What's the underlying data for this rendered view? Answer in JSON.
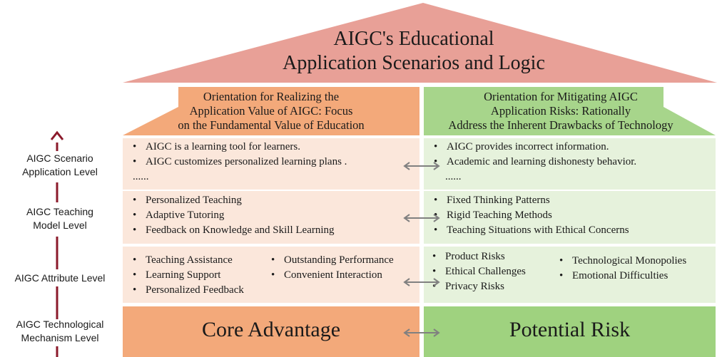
{
  "roof": {
    "title_line1": "AIGC's Educational",
    "title_line2": "Application Scenarios and Logic"
  },
  "left_orientation": {
    "line1": "Orientation for Realizing the",
    "line2": "Application Value of AIGC: Focus",
    "line3": "on the Fundamental Value of Education"
  },
  "right_orientation": {
    "line1": "Orientation for Mitigating AIGC",
    "line2": "Application Risks: Rationally",
    "line3": "Address the Inherent Drawbacks of Technology"
  },
  "levels": {
    "scenario": {
      "line1": "AIGC Scenario",
      "line2": "Application Level"
    },
    "teaching": {
      "line1": "AIGC Teaching",
      "line2": "Model Level"
    },
    "attribute": {
      "line1": "AIGC Attribute Level"
    },
    "mechanism": {
      "line1": "AIGC Technological",
      "line2": "Mechanism Level"
    }
  },
  "scenario_row": {
    "left": [
      "AIGC is a learning tool for learners.",
      "AIGC customizes personalized learning plans ."
    ],
    "left_more": "......",
    "right": [
      "AIGC provides incorrect information.",
      "Academic and learning dishonesty behavior."
    ],
    "right_more": "......"
  },
  "teaching_row": {
    "left": [
      "Personalized Teaching",
      "Adaptive Tutoring",
      "Feedback on Knowledge and Skill Learning"
    ],
    "right": [
      "Fixed Thinking Patterns",
      "Rigid Teaching Methods",
      "Teaching Situations with Ethical Concerns"
    ]
  },
  "attribute_row": {
    "left_col1": [
      "Teaching Assistance",
      "Learning Support",
      "Personalized Feedback"
    ],
    "left_col2": [
      "Outstanding Performance",
      "Convenient Interaction"
    ],
    "right_col1": [
      "Product Risks",
      "Ethical Challenges",
      "Privacy Risks"
    ],
    "right_col2": [
      "Technological Monopolies",
      "Emotional Difficulties"
    ]
  },
  "mechanism_row": {
    "left": "Core Advantage",
    "right": "Potential Risk"
  },
  "colors": {
    "roof": "#e8a097",
    "left_header": "#f3a97a",
    "right_header": "#a7d58b",
    "left_panel": "#fbe7db",
    "right_panel": "#e6f2dc",
    "left_base": "#f3a97a",
    "right_base": "#9fd27f",
    "axis_arrow": "#8b1a2b",
    "double_arrow": "#808080"
  }
}
